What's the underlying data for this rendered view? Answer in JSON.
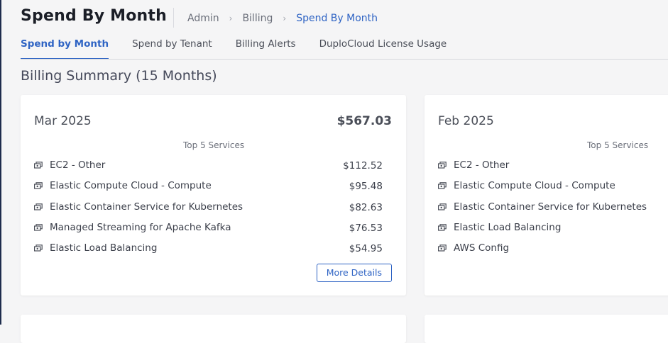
{
  "header": {
    "title": "Spend By Month",
    "breadcrumb": [
      "Admin",
      "Billing",
      "Spend By Month"
    ]
  },
  "tabs": [
    {
      "label": "Spend by Month",
      "active": true
    },
    {
      "label": "Spend by Tenant",
      "active": false
    },
    {
      "label": "Billing Alerts",
      "active": false
    },
    {
      "label": "DuploCloud License Usage",
      "active": false
    }
  ],
  "section_title": "Billing Summary (15 Months)",
  "cards": [
    {
      "month": "Mar 2025",
      "total": "$567.03",
      "services_heading": "Top 5 Services",
      "services": [
        {
          "name": "EC2 - Other",
          "cost": "$112.52"
        },
        {
          "name": "Elastic Compute Cloud - Compute",
          "cost": "$95.48"
        },
        {
          "name": "Elastic Container Service for Kubernetes",
          "cost": "$82.63"
        },
        {
          "name": "Managed Streaming for Apache Kafka",
          "cost": "$76.53"
        },
        {
          "name": "Elastic Load Balancing",
          "cost": "$54.95"
        }
      ],
      "more_details": "More Details"
    },
    {
      "month": "Feb 2025",
      "services_heading": "Top 5 Services",
      "services": [
        {
          "name": "EC2 - Other"
        },
        {
          "name": "Elastic Compute Cloud - Compute"
        },
        {
          "name": "Elastic Container Service for Kubernetes"
        },
        {
          "name": "Elastic Load Balancing"
        },
        {
          "name": "AWS Config"
        }
      ]
    }
  ],
  "icons": {
    "service": "money-icon"
  },
  "colors": {
    "accent": "#2f64c4",
    "sidebar_edge": "#1f2d4d"
  }
}
